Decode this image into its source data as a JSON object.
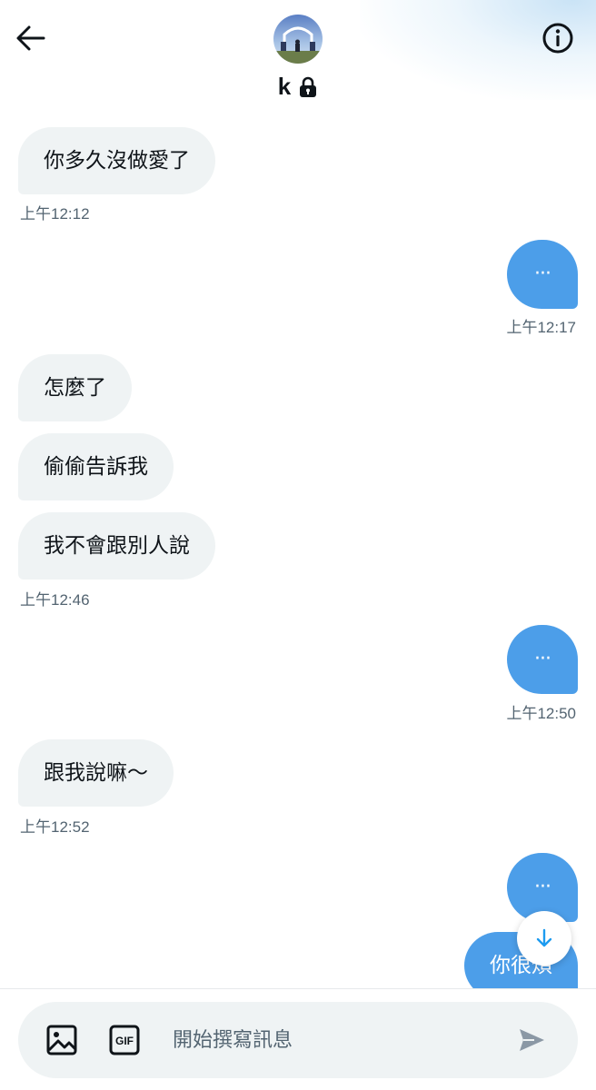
{
  "header": {
    "name": "k",
    "avatar_description": "landscape with archway"
  },
  "messages": [
    {
      "id": "m1",
      "side": "in",
      "text": "你多久沒做愛了"
    },
    {
      "id": "t1",
      "timestamp": "上午12:12"
    },
    {
      "id": "m2",
      "side": "out",
      "text": "···"
    },
    {
      "id": "t2",
      "timestamp": "上午12:17"
    },
    {
      "id": "m3",
      "side": "in",
      "text": "怎麼了"
    },
    {
      "id": "m4",
      "side": "in",
      "text": "偷偷告訴我"
    },
    {
      "id": "m5",
      "side": "in",
      "text": "我不會跟別人說"
    },
    {
      "id": "t3",
      "timestamp": "上午12:46"
    },
    {
      "id": "m6",
      "side": "out",
      "text": "···"
    },
    {
      "id": "t4",
      "timestamp": "上午12:50"
    },
    {
      "id": "m7",
      "side": "in",
      "text": "跟我說嘛～"
    },
    {
      "id": "t5",
      "timestamp": "上午12:52"
    },
    {
      "id": "m8",
      "side": "out",
      "text": "···"
    },
    {
      "id": "m9",
      "side": "out",
      "text": "你很煩"
    }
  ],
  "composer": {
    "placeholder": "開始撰寫訊息"
  },
  "icons": {
    "back": "arrow-left-icon",
    "info": "info-icon",
    "lock": "lock-icon",
    "image": "image-icon",
    "gif": "gif-icon",
    "send": "send-icon",
    "scroll_down": "arrow-down-icon"
  },
  "colors": {
    "outgoing_bubble": "#4c9ee9",
    "incoming_bubble": "#eff3f4",
    "timestamp": "#536471",
    "text": "#0f1419"
  }
}
